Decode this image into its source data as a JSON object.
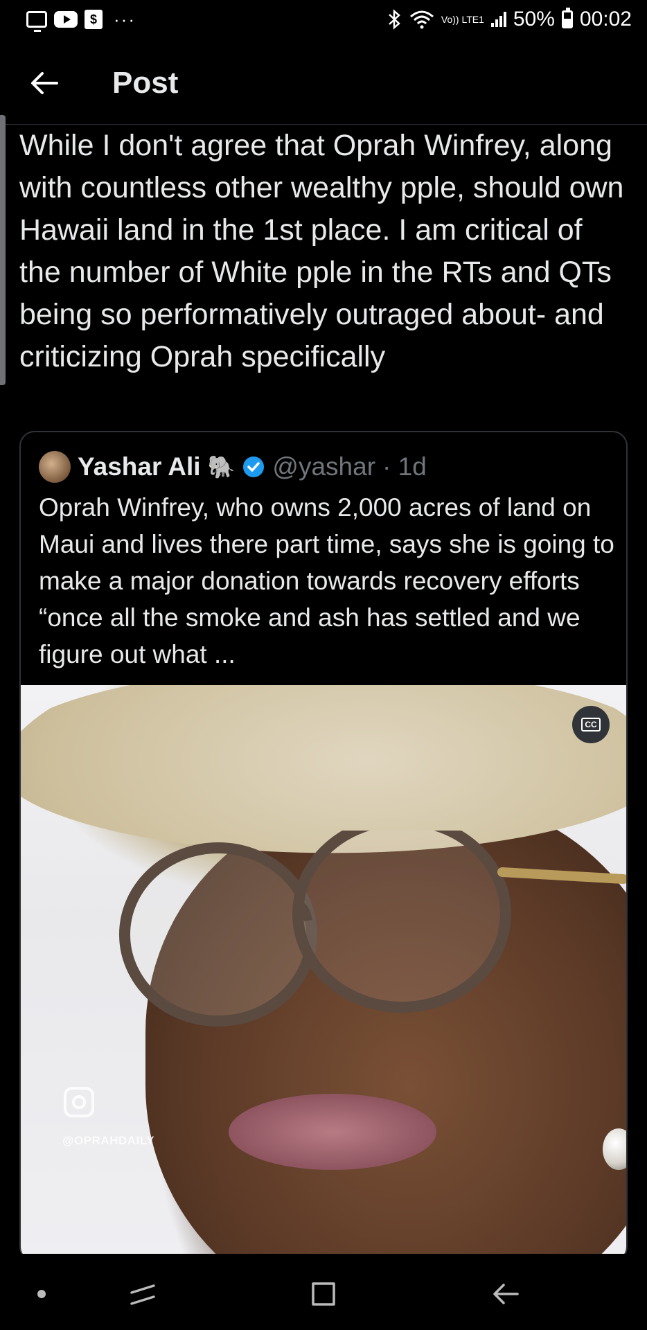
{
  "status_bar": {
    "network_label": "Vo)) LTE1",
    "battery": "50%",
    "time": "00:02"
  },
  "app_bar": {
    "title": "Post"
  },
  "post": {
    "text": "While I don't agree that Oprah Winfrey, along with countless other wealthy pple, should own Hawaii land in the 1st place. I am critical of the number of White pple in the RTs and QTs being so performatively outraged about- and criticizing Oprah specifically"
  },
  "quoted_post": {
    "author_name": "Yashar Ali",
    "author_emoji": "🐘",
    "handle": "@yashar",
    "time_ago": "· 1d",
    "text": "Oprah Winfrey, who owns 2,000 acres of land on Maui and lives there part time, says she is going to make a major donation towards recovery efforts “once all the smoke and ash has settled and we figure out what ...",
    "media": {
      "cc_label": "CC",
      "watermark": "@OPRAHDAILY"
    }
  },
  "colors": {
    "background": "#000000",
    "text": "#e7e9ea",
    "secondary_text": "#71767b",
    "border": "#2f3336",
    "verified_blue": "#1d9bf0"
  }
}
